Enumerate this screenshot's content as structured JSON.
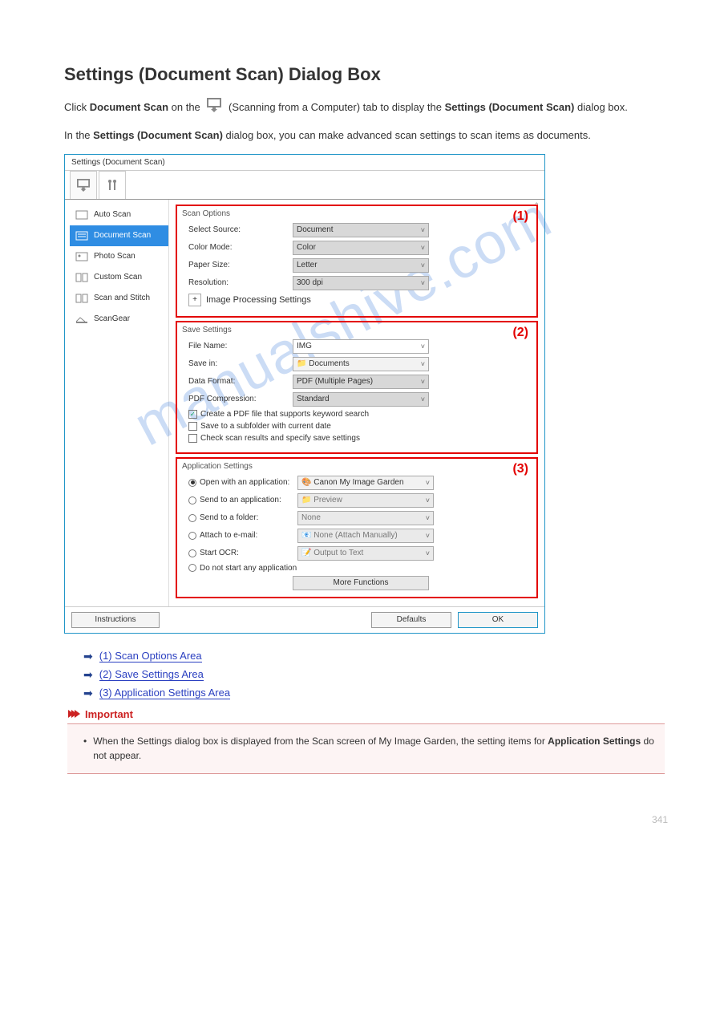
{
  "title": "Settings (Document Scan) Dialog Box",
  "intro_before": "Click ",
  "intro_bold": "Document Scan",
  "intro_mid": " on the ",
  "intro_after": " (Scanning from a Computer) tab to display the ",
  "intro_bold2": "Settings (Document Scan)",
  "intro_tail": " dialog box.",
  "para2_before": "In the ",
  "para2_bold": "Settings (Document Scan)",
  "para2_after": " dialog box, you can make advanced scan settings to scan items as documents.",
  "dialog": {
    "title": "Settings (Document Scan)",
    "sidebar": [
      "Auto Scan",
      "Document Scan",
      "Photo Scan",
      "Custom Scan",
      "Scan and Stitch",
      "ScanGear"
    ],
    "scan_options": {
      "heading": "Scan Options",
      "marker": "(1)",
      "source_label": "Select Source:",
      "source_value": "Document",
      "color_label": "Color Mode:",
      "color_value": "Color",
      "paper_label": "Paper Size:",
      "paper_value": "Letter",
      "res_label": "Resolution:",
      "res_value": "300 dpi",
      "imgproc": "Image Processing Settings"
    },
    "save": {
      "heading": "Save Settings",
      "marker": "(2)",
      "filename_label": "File Name:",
      "filename_value": "IMG",
      "savein_label": "Save in:",
      "savein_value": "Documents",
      "format_label": "Data Format:",
      "format_value": "PDF (Multiple Pages)",
      "comp_label": "PDF Compression:",
      "comp_value": "Standard",
      "chk1": "Create a PDF file that supports keyword search",
      "chk2": "Save to a subfolder with current date",
      "chk3": "Check scan results and specify save settings"
    },
    "app": {
      "heading": "Application Settings",
      "marker": "(3)",
      "r1_label": "Open with an application:",
      "r1_value": "Canon My Image Garden",
      "r2_label": "Send to an application:",
      "r2_value": "Preview",
      "r3_label": "Send to a folder:",
      "r3_value": "None",
      "r4_label": "Attach to e-mail:",
      "r4_value": "None (Attach Manually)",
      "r5_label": "Start OCR:",
      "r5_value": "Output to Text",
      "r6_label": "Do not start any application",
      "more": "More Functions"
    },
    "footer": {
      "instructions": "Instructions",
      "defaults": "Defaults",
      "ok": "OK"
    }
  },
  "links": {
    "l1": "(1) Scan Options Area",
    "l2": "(2) Save Settings Area",
    "l3": "(3) Application Settings Area"
  },
  "important": {
    "heading": "Important",
    "b1": "When the Settings dialog box is displayed from the Scan screen of My Image Garden, the setting items for ",
    "b1_bold": "Application Settings",
    "b1_tail": " do not appear."
  },
  "pagenum": "341",
  "watermark": "manualshive.com"
}
